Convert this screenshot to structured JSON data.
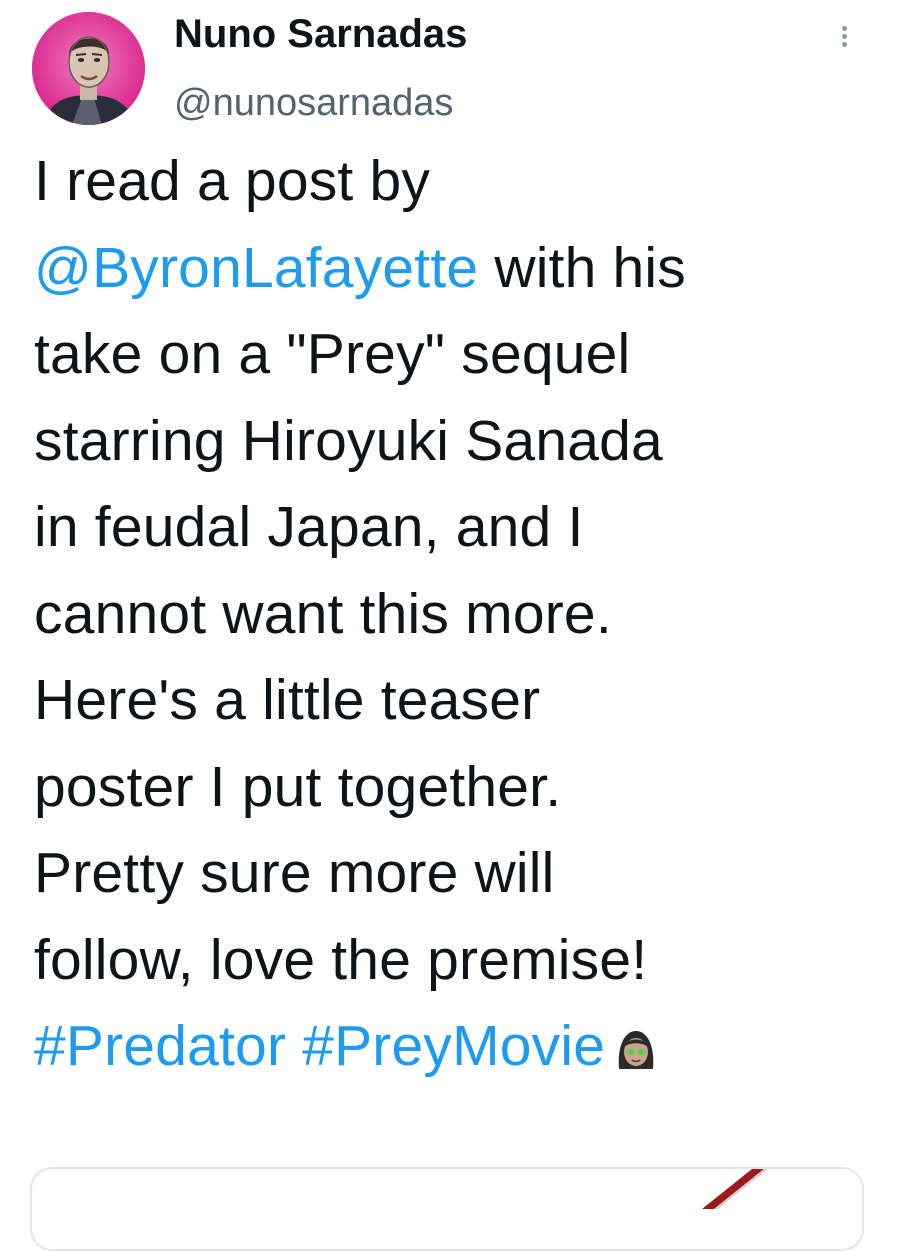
{
  "author": {
    "display_name": "Nuno Sarnadas",
    "handle": "@nunosarnadas",
    "avatar": "profile-photo-avatar"
  },
  "menu": {
    "icon": "vertical-dots-icon"
  },
  "tweet": {
    "lines": [
      "I read a post by",
      "with his",
      "take on a \"Prey\" sequel",
      "starring Hiroyuki Sanada",
      "in feudal Japan, and I",
      "cannot want this more.",
      "Here's a little teaser",
      "poster I put together.",
      "Pretty sure more will",
      "follow, love the premise!"
    ],
    "mention": "@ByronLafayette",
    "hashtags": [
      "#Predator",
      "#PreyMovie"
    ],
    "emoji": "woman-face-emoji"
  },
  "colors": {
    "link": "#1d9bf0",
    "text": "#0f1419",
    "secondary": "#536471",
    "avatar_bg": "#e6359e",
    "media_accent": "#9b1b1b"
  },
  "media": {
    "type": "image-preview"
  }
}
